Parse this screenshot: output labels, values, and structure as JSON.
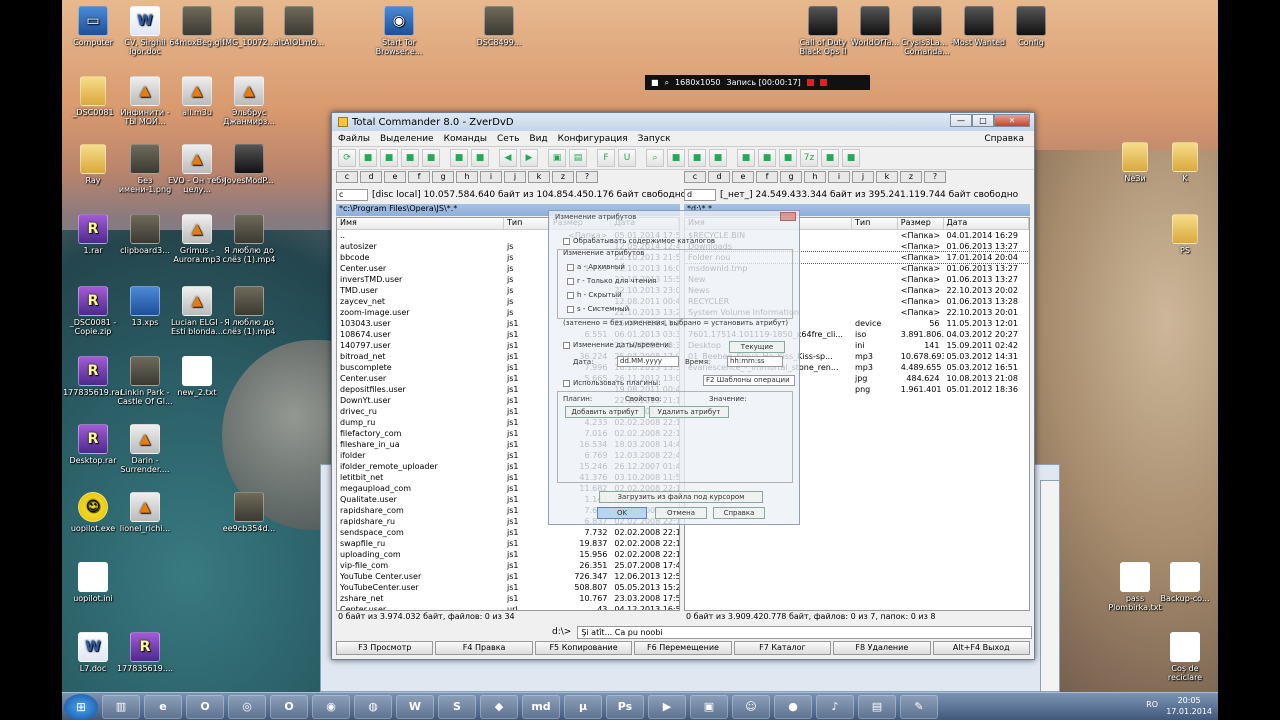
{
  "desktop_left": [
    {
      "label": "Computer",
      "icon": "computer-icon"
    },
    {
      "label": "CV, Sirghii Igor.doc",
      "icon": "word-doc-icon"
    },
    {
      "label": "64moxBeg.gif",
      "icon": "image-icon"
    },
    {
      "label": "IMG_10072...",
      "icon": "image-icon"
    },
    {
      "label": "altAIOLmO...",
      "icon": "image-icon"
    },
    {
      "label": "Start Tor Browser.e...",
      "icon": "tor-browser-icon"
    },
    {
      "label": "DSC8499...",
      "icon": "image-icon"
    },
    {
      "label": "_DSC0081",
      "icon": "folder-icon"
    },
    {
      "label": "Инфинити - ТЫ МОЙ...",
      "icon": "audio-file-icon"
    },
    {
      "label": "all.m3u",
      "icon": "playlist-icon"
    },
    {
      "label": "Эльбрус Джанмирз...",
      "icon": "audio-file-icon"
    },
    {
      "label": "Ray",
      "icon": "folder-icon"
    },
    {
      "label": "Без имени-1.png",
      "icon": "image-icon"
    },
    {
      "label": "EVO - Он тебя целу...",
      "icon": "audio-file-icon"
    },
    {
      "label": "JovesModP...",
      "icon": "world-of-tanks-icon"
    },
    {
      "label": "1.rar",
      "icon": "rar-archive-icon"
    },
    {
      "label": "clipboard3...",
      "icon": "image-icon"
    },
    {
      "label": "Grimus - Aurora.mp3",
      "icon": "audio-file-icon"
    },
    {
      "label": "Я люблю до слёз (1).mp4",
      "icon": "video-file-icon"
    },
    {
      "label": "_DSC0081 - Copie.zip",
      "icon": "rar-archive-icon"
    },
    {
      "label": "13.xps",
      "icon": "xps-file-icon"
    },
    {
      "label": "Lucian ELGI - Esti blonda...",
      "icon": "audio-file-icon"
    },
    {
      "label": "Я люблю до слёз (1).mp4",
      "icon": "video-file-icon"
    },
    {
      "label": "177835619.rar",
      "icon": "rar-archive-icon"
    },
    {
      "label": "Linkin Park - Castle Of Gl...",
      "icon": "image-icon"
    },
    {
      "label": "new_2.txt",
      "icon": "text-file-icon"
    },
    {
      "label": "Desktop.rar",
      "icon": "rar-archive-icon"
    },
    {
      "label": "Darin - Surrender....",
      "icon": "audio-file-icon"
    },
    {
      "label": "uopilot.exe",
      "icon": "smiley-icon"
    },
    {
      "label": "lionel_richi...",
      "icon": "audio-file-icon"
    },
    {
      "label": "ee9cb354d...",
      "icon": "image-icon"
    },
    {
      "label": "uopilot.ini",
      "icon": "settings-file-icon"
    },
    {
      "label": "L7.doc",
      "icon": "word-doc-icon"
    },
    {
      "label": "177835619....",
      "icon": "rar-archive-icon"
    }
  ],
  "desktop_right": [
    {
      "label": "Call of Duty Black Ops II",
      "icon": "game-icon"
    },
    {
      "label": "WorldOfTa...",
      "icon": "world-of-tanks-icon"
    },
    {
      "label": "Crysis3La... - Comanda...",
      "icon": "game-icon"
    },
    {
      "label": "Most Wanted",
      "icon": "game-icon"
    },
    {
      "label": "Config",
      "icon": "game-icon"
    },
    {
      "label": "NeЗи",
      "icon": "folder-icon"
    },
    {
      "label": "K",
      "icon": "folder-icon"
    },
    {
      "label": "PS",
      "icon": "folder-icon"
    },
    {
      "label": "pass Plombirka.txt",
      "icon": "text-file-icon"
    },
    {
      "label": "Backup-co...",
      "icon": "text-file-icon"
    },
    {
      "label": "Coș de reciclare",
      "icon": "recycle-bin-icon"
    }
  ],
  "recbar": {
    "resolution": "1680x1050",
    "record": "Запись [00:00:17]"
  },
  "tc": {
    "title": "Total Commander 8.0 - ZverDvD",
    "menus": [
      "Файлы",
      "Выделение",
      "Команды",
      "Сеть",
      "Вид",
      "Конфигурация",
      "Запуск"
    ],
    "help": "Справка",
    "left": {
      "drive": "c",
      "drive_info": "[disc local]  10.057.584.640 байт из 104.854.450.176 байт свободно",
      "path": "*c:\\Program Files\\Opera\\JS\\*.*",
      "columns": [
        "Имя",
        "Тип",
        "Размер",
        "Дата"
      ],
      "rows": [
        {
          "name": "..",
          "type": "",
          "size": "<Папка>",
          "date": "05.01.2014 17:55"
        },
        {
          "name": "autosizer",
          "type": "js",
          "size": "",
          "date": "12.05.2014 12:43"
        },
        {
          "name": "bbcode",
          "type": "js",
          "size": "",
          "date": "22.10.2013 21:50"
        },
        {
          "name": "Center.user",
          "type": "js",
          "size": "1.765",
          "date": "22.10.2013 16:05"
        },
        {
          "name": "inversTMD.user",
          "type": "js",
          "size": "",
          "date": "22.10.2013 15:54"
        },
        {
          "name": "TMD.user",
          "type": "js",
          "size": "",
          "date": "22.10.2013 23:09"
        },
        {
          "name": "zaycev_net",
          "type": "js",
          "size": "",
          "date": "12.08.2011 00:43"
        },
        {
          "name": "zoom-image.user",
          "type": "js",
          "size": "",
          "date": "22.10.2013 13:25"
        },
        {
          "name": "103043.user",
          "type": "js1",
          "size": "",
          "date": "25.07.2008 11:22"
        },
        {
          "name": "108674.user",
          "type": "js1",
          "size": "6.551",
          "date": "06.01.2013 03:30"
        },
        {
          "name": "140797.user",
          "type": "js1",
          "size": "",
          "date": "22.10.2013 18:34"
        },
        {
          "name": "bitroad_net",
          "type": "js1",
          "size": "36.224",
          "date": "25.07.2008 17:01"
        },
        {
          "name": "buscomplete",
          "type": "js1",
          "size": "7.996",
          "date": "16.10.2013 13:33"
        },
        {
          "name": "Center.user",
          "type": "js1",
          "size": "5.665",
          "date": "26.11.2012 13:01"
        },
        {
          "name": "depositfiles.user",
          "type": "js1",
          "size": "",
          "date": "19.08.2011 00:43"
        },
        {
          "name": "DownYt.user",
          "type": "js1",
          "size": "",
          "date": "22.10.2013 21:12"
        },
        {
          "name": "drivec_ru",
          "type": "js1",
          "size": "",
          "date": "16.10.2011 00:43"
        },
        {
          "name": "dump_ru",
          "type": "js1",
          "size": "4.233",
          "date": "02.02.2008 22:14"
        },
        {
          "name": "filefactory_com",
          "type": "js1",
          "size": "7.016",
          "date": "02.02.2008 22:14"
        },
        {
          "name": "fileshare_in_ua",
          "type": "js1",
          "size": "16.534",
          "date": "18.03.2008 14:45"
        },
        {
          "name": "ifolder",
          "type": "js1",
          "size": "6.769",
          "date": "12.03.2008 22:42"
        },
        {
          "name": "ifolder_remote_uploader",
          "type": "js1",
          "size": "15.246",
          "date": "26.12.2007 01:41"
        },
        {
          "name": "letitbit_net",
          "type": "js1",
          "size": "41.376",
          "date": "03.10.2008 11:56"
        },
        {
          "name": "megaupload_com",
          "type": "js1",
          "size": "11.682",
          "date": "02.02.2008 22:14"
        },
        {
          "name": "Qualitate.user",
          "type": "js1",
          "size": "1.143",
          "date": "01.02.2012 12:04"
        },
        {
          "name": "rapidshare_com",
          "type": "js1",
          "size": "7.687",
          "date": "02.02.2008 22:14"
        },
        {
          "name": "rapidshare_ru",
          "type": "js1",
          "size": "6.837",
          "date": "02.02.2008 22:14"
        },
        {
          "name": "sendspace_com",
          "type": "js1",
          "size": "7.732",
          "date": "02.02.2008 22:14"
        },
        {
          "name": "swapfile_ru",
          "type": "js1",
          "size": "19.837",
          "date": "02.02.2008 22:14"
        },
        {
          "name": "uploading_com",
          "type": "js1",
          "size": "15.956",
          "date": "02.02.2008 22:14"
        },
        {
          "name": "vip-file_com",
          "type": "js1",
          "size": "26.351",
          "date": "25.07.2008 17:42"
        },
        {
          "name": "YouTube Center.user",
          "type": "js1",
          "size": "726.347",
          "date": "12.06.2013 12:55"
        },
        {
          "name": "YouTubeCenter.user",
          "type": "js1",
          "size": "508.807",
          "date": "05.05.2013 15:27"
        },
        {
          "name": "zshare_net",
          "type": "js1",
          "size": "10.767",
          "date": "23.03.2008 17:57"
        },
        {
          "name": "Center.user",
          "type": "url",
          "size": "43",
          "date": "04.12.2013 16:55"
        }
      ],
      "status": "0 байт из 3.974.032 байт, файлов: 0 из 34"
    },
    "right": {
      "drive": "d",
      "drive_info": "[_нет_]  24.549.433.344 байт из 395.241.119.744 байт свободно",
      "path": "*d:\\*.*",
      "columns": [
        "Имя",
        "Тип",
        "Размер",
        "Дата"
      ],
      "rows": [
        {
          "name": "$RECYCLE.BIN",
          "type": "",
          "size": "<Папка>",
          "date": "04.01.2014 16:29"
        },
        {
          "name": "Downloads",
          "type": "",
          "size": "<Папка>",
          "date": "01.06.2013 13:27"
        },
        {
          "name": "Folder nou",
          "type": "",
          "size": "<Папка>",
          "date": "17.01.2014 20:04"
        },
        {
          "name": "msdownld.tmp",
          "type": "",
          "size": "<Папка>",
          "date": "01.06.2013 13:27"
        },
        {
          "name": "New",
          "type": "",
          "size": "<Папка>",
          "date": "01.06.2013 13:27"
        },
        {
          "name": "News",
          "type": "",
          "size": "<Папка>",
          "date": "22.10.2013 20:02"
        },
        {
          "name": "RECYCLER",
          "type": "",
          "size": "<Папка>",
          "date": "01.06.2013 13:28"
        },
        {
          "name": "System Volume Information",
          "type": "",
          "size": "<Папка>",
          "date": "22.10.2013 20:01"
        },
        {
          "name": "",
          "type": "device",
          "size": "56",
          "date": "11.05.2013 12:01"
        },
        {
          "name": "7601.17514.101119-1850_x64fre_cli...",
          "type": "iso",
          "size": "3.891.806.208",
          "date": "04.03.2012 20:27"
        },
        {
          "name": "Desktop",
          "type": "ini",
          "size": "141",
          "date": "15.09.2011 02:42"
        },
        {
          "name": "01_Beebee_Shiva_Ha_Kiss_Kiss-sp...",
          "type": "mp3",
          "size": "10.678.693",
          "date": "05.03.2012 14:31"
        },
        {
          "name": "evanescence_-_immortal_stone_ren...",
          "type": "mp3",
          "size": "4.489.655",
          "date": "05.03.2012 16:51"
        },
        {
          "name": "",
          "type": "jpg",
          "size": "484.624",
          "date": "10.08.2013 21:08"
        },
        {
          "name": "",
          "type": "png",
          "size": "1.961.401",
          "date": "05.01.2012 18:36"
        }
      ],
      "status": "0 байт из 3.909.420.778 байт, файлов: 0 из 7, папок: 0 из 8"
    },
    "cmd_prompt": "d:\\>",
    "cmd_value": "Şi atît... Ca pu noobi",
    "fkeys": [
      "F3 Просмотр",
      "F4 Правка",
      "F5 Копирование",
      "F6 Перемещение",
      "F7 Каталог",
      "F8 Удаление",
      "Alt+F4 Выход"
    ]
  },
  "dialog": {
    "title": "Изменение атрибутов",
    "process_subdirs": "Обрабатывать содержимое каталогов",
    "change_attrs": "Изменение атрибутов",
    "attrs": [
      "a - Архивный",
      "r - Только для чтения",
      "h - Скрытый",
      "s - Системный"
    ],
    "note": "(затенено = без изменения, выбрано = установить атрибут)",
    "change_datetime": "Изменение даты/времени:",
    "date_label": "Дата:",
    "date_value": "dd.MM.yyyy",
    "time_label": "Время:",
    "time_value": "hh:mm:ss",
    "current_button": "Текущие",
    "use_plugins": "Использовать плагины:",
    "plugin_select": "F2 Шаблоны операции",
    "plugin_col": "Плагин:",
    "prop_col": "Свойство:",
    "value_col": "Значение:",
    "add_attr": "Добавить атрибут",
    "remove_attr": "Удалить атрибут",
    "load_from_file": "Загрузить из файла под курсором",
    "ok": "OK",
    "cancel": "Отмена",
    "help": "Справка"
  },
  "taskbar": {
    "apps": [
      "file-manager-icon",
      "ie-icon",
      "opera-icon",
      "tor-icon",
      "opera-alt-icon",
      "chrome-icon",
      "firefox-icon",
      "word-icon",
      "skype-icon",
      "game-icon",
      "md-icon",
      "utorrent-icon",
      "photoshop-icon",
      "player-icon",
      "save-icon",
      "smiley-icon",
      "record-icon",
      "media-icon",
      "tc-icon",
      "paint-icon"
    ],
    "lang": "RO",
    "time": "20:05",
    "date": "17.01.2014"
  }
}
